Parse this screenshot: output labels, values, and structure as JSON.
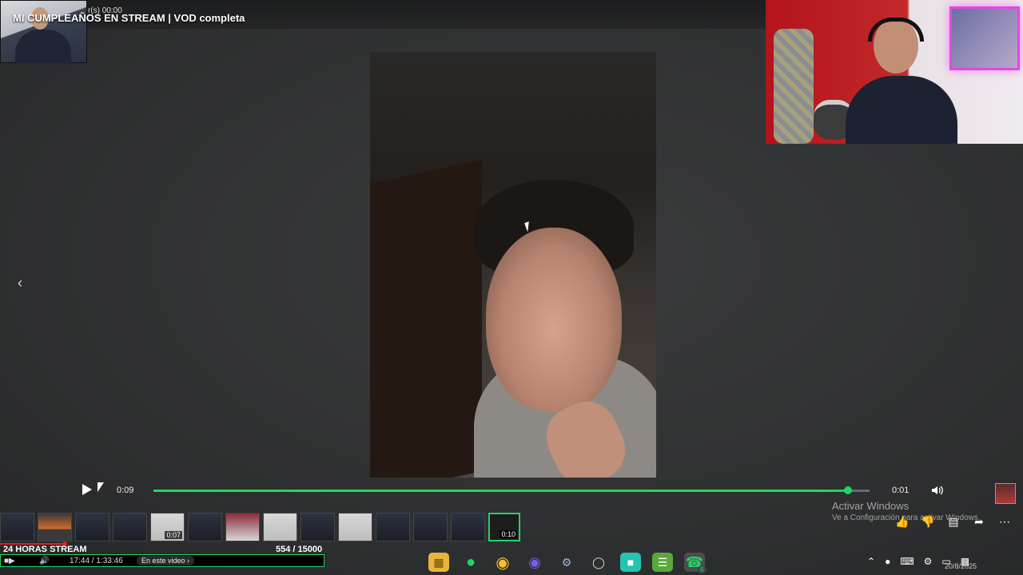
{
  "header": {
    "small_time": "r(s) 00:00",
    "title": "MI CUMPLEAÑOS EN STREAM | VOD completa"
  },
  "player": {
    "current_time": "0:09",
    "end_time": "0:01",
    "progress": 0.97
  },
  "watermark": {
    "line1": "Activar Windows",
    "line2": "Ve a Configuración para activar Windows."
  },
  "thumbnails": [
    {
      "style": "dark"
    },
    {
      "style": "orange"
    },
    {
      "style": "dark"
    },
    {
      "style": "dark"
    },
    {
      "style": "light",
      "label": "0:07"
    },
    {
      "style": "dark"
    },
    {
      "style": "red"
    },
    {
      "style": "light"
    },
    {
      "style": "dark"
    },
    {
      "style": "light"
    },
    {
      "style": "dark"
    },
    {
      "style": "dark"
    },
    {
      "style": "dark"
    },
    {
      "style": "active",
      "label": "0:10"
    }
  ],
  "stream_bar": {
    "title": "24 HORAS STREAM",
    "count": "554  / 15000",
    "time": "17:44 / 1:33:46",
    "chip": "En este video",
    "progress": 0.2
  },
  "taskbar": {
    "whatsapp_badge": "6",
    "date": "20/8/2025"
  },
  "colors": {
    "accent_green": "#1ed760",
    "progress_red": "#e01e2b"
  }
}
